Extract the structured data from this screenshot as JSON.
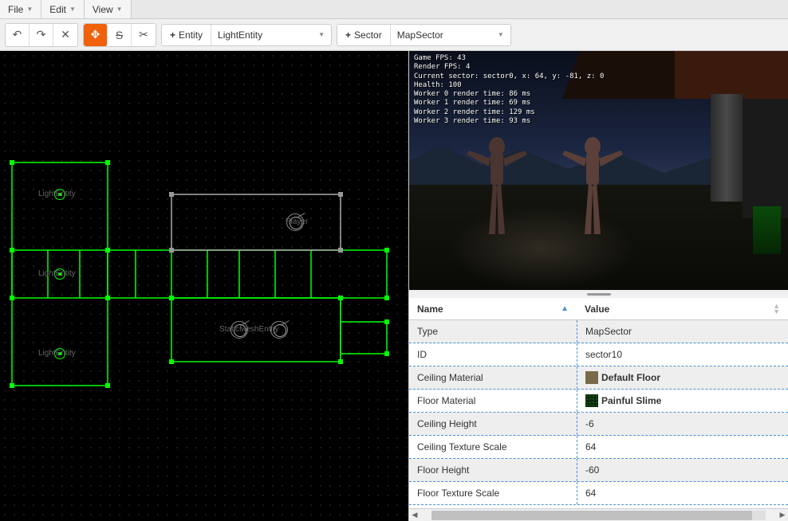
{
  "menu": {
    "file": "File",
    "edit": "Edit",
    "view": "View"
  },
  "toolbar": {
    "entity_btn": "Entity",
    "entity_select": "LightEntity",
    "sector_btn": "Sector",
    "sector_select": "MapSector"
  },
  "preview_stats": {
    "l1": "Game FPS: 43",
    "l2": "Render FPS: 4",
    "l3": "Current sector: sector0, x: 64, y: -81, z: 0",
    "l4": "Health: 100",
    "l5": "Worker 0 render time: 86 ms",
    "l6": "Worker 1 render time: 69 ms",
    "l7": "Worker 2 render time: 129 ms",
    "l8": "Worker 3 render time: 93 ms"
  },
  "map_labels": {
    "light": "LightEntity",
    "player": "Player",
    "static": "StaticMeshEntity"
  },
  "props": {
    "header_name": "Name",
    "header_value": "Value",
    "rows": [
      {
        "name": "Type",
        "value": "MapSector"
      },
      {
        "name": "ID",
        "value": "sector10"
      },
      {
        "name": "Ceiling Material",
        "value": "Default Floor"
      },
      {
        "name": "Floor Material",
        "value": "Painful Slime"
      },
      {
        "name": "Ceiling Height",
        "value": "-6"
      },
      {
        "name": "Ceiling Texture Scale",
        "value": "64"
      },
      {
        "name": "Floor Height",
        "value": "-60"
      },
      {
        "name": "Floor Texture Scale",
        "value": "64"
      }
    ]
  }
}
